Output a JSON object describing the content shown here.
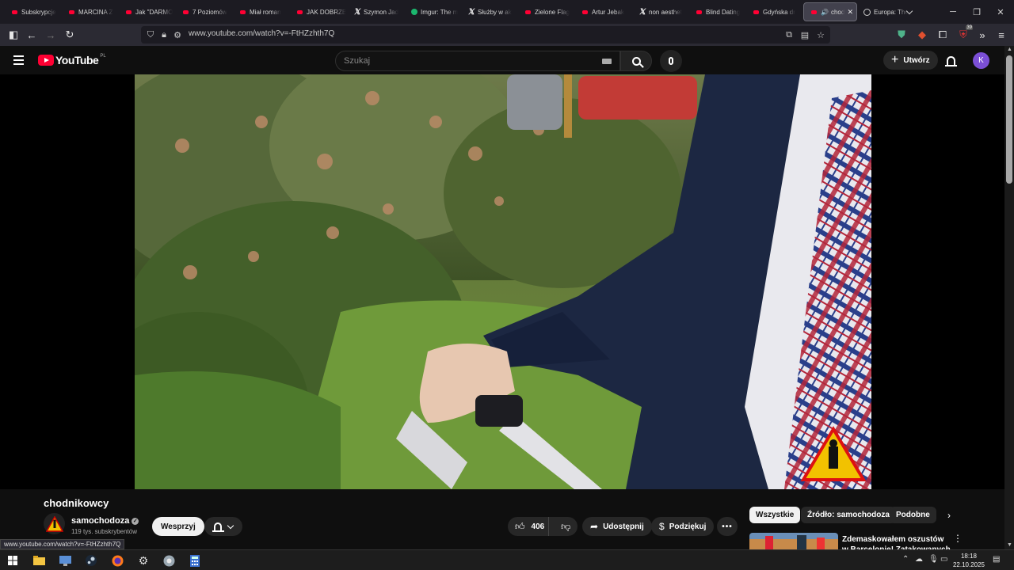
{
  "browser": {
    "tabs": [
      {
        "label": "Subskrypcje",
        "icon": "youtube-icon"
      },
      {
        "label": "MARCINA Z",
        "icon": "youtube-icon"
      },
      {
        "label": "Jak \"DARMO",
        "icon": "youtube-icon"
      },
      {
        "label": "7 Poziomów",
        "icon": "youtube-icon"
      },
      {
        "label": "Miał roman",
        "icon": "youtube-icon"
      },
      {
        "label": "JAK DOBRZE",
        "icon": "youtube-icon"
      },
      {
        "label": "Szymon Jad",
        "icon": "x-icon"
      },
      {
        "label": "Imgur: The m",
        "icon": "imgur-icon"
      },
      {
        "label": "Służby w ak",
        "icon": "x-icon"
      },
      {
        "label": "Zielone Flag",
        "icon": "youtube-icon"
      },
      {
        "label": "Artur Jebak",
        "icon": "youtube-icon"
      },
      {
        "label": "non aesthet",
        "icon": "x-icon"
      },
      {
        "label": "Blind Dating",
        "icon": "youtube-icon"
      },
      {
        "label": "Gdyńska dr",
        "icon": "youtube-icon"
      }
    ],
    "active_tab": {
      "label": "chod",
      "icon": "youtube-icon"
    },
    "after_tab": {
      "label": "Europa: The",
      "icon": "globe-icon"
    },
    "url": "www.youtube.com/watch?v=-FtHZzhth7Q",
    "extension_badge": "39",
    "status_url": "www.youtube.com/watch?v=-FtHZzhth7Q"
  },
  "youtube": {
    "logo_text": "YouTube",
    "country_code": "PL",
    "search_placeholder": "Szukaj",
    "create_label": "Utwórz",
    "avatar_letter": "K"
  },
  "video": {
    "title": "chodnikowcy",
    "channel": "samochodoza",
    "subscribers": "119 tys. subskrybentów",
    "support_label": "Wesprzyj",
    "likes": "406",
    "share_label": "Udostępnij",
    "thanks_label": "Podziękuj",
    "more_label": "•••"
  },
  "recommendations": {
    "chips": [
      {
        "label": "Wszystkie",
        "selected": true
      },
      {
        "label": "Źródło: samochodoza",
        "selected": false
      },
      {
        "label": "Podobne",
        "selected": false
      }
    ],
    "first_title": "Zdemaskowałem oszustów w Barcelonie! Zatakowanych"
  },
  "taskbar": {
    "time": "18:18",
    "date": "22.10.2025"
  },
  "colors": {
    "accent_red": "#ff0033",
    "avatar": "#7b4fd6"
  }
}
